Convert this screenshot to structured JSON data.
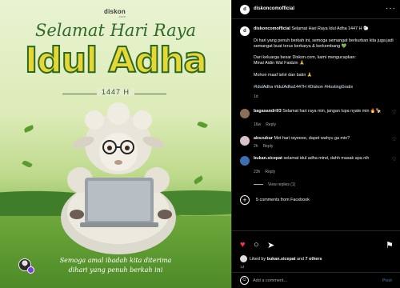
{
  "image": {
    "brand": "diskon",
    "brand_sub": ".com",
    "greeting_line1": "Selamat Hari Raya",
    "greeting_line2": "Idul Adha",
    "year": "1447 H",
    "caption_line1": "Semoga amal ibadah kita diterima",
    "caption_line2": "dihari yang penuh berkah ini"
  },
  "header": {
    "username": "diskoncomofficial",
    "more_icon": "more-icon"
  },
  "post": {
    "username": "diskoncomofficial",
    "line1": "Selamat Hari Raya Idul Adha 1447 H 🐑",
    "para1": "Di hari yang penuh berkah ini, semoga semangat berkurban kita juga jadi semangat buat terus berkarya & berkembang 💚",
    "para2": "Dari keluarga besar Diskon.com, kami mengucapkan:",
    "para2b": "Minal Aidin Wal Faidzin 🙏",
    "para3": "Mohon maaf lahir dan batin 🙏",
    "hashtags": "#IdulAdha #IdulAdha1447H #Diskon #HostingGratis",
    "time": "1d"
  },
  "comments": [
    {
      "username": "bagasandri03",
      "text": "Selamat hari raya min, jangan lupa nyate min 🔥🍢",
      "time": "16w",
      "reply": "Reply"
    },
    {
      "username": "abszubur",
      "text": "Met hari rayeeee, dapet wahyu ga min?",
      "time": "2h",
      "reply": "Reply"
    },
    {
      "username": "bukan.sicepat",
      "text": "selamat idul adha mind, dahh masak apa nih",
      "text2": "nih??",
      "time": "23h",
      "reply": "Reply",
      "view_replies": "View replies (1)"
    }
  ],
  "facebook_comments": "5 comments from Facebook",
  "actions": {
    "liked_by_prefix": "Liked by ",
    "liked_by_user": "bukan.sicepat",
    "liked_by_suffix": " and ",
    "liked_by_others": "7 others",
    "date": "1d"
  },
  "comment_box": {
    "placeholder": "Add a comment...",
    "post_label": "Post"
  },
  "colors": {
    "accent_like": "#ff3040",
    "title_yellow": "#e7d634",
    "title_green": "#2d6a2c"
  }
}
